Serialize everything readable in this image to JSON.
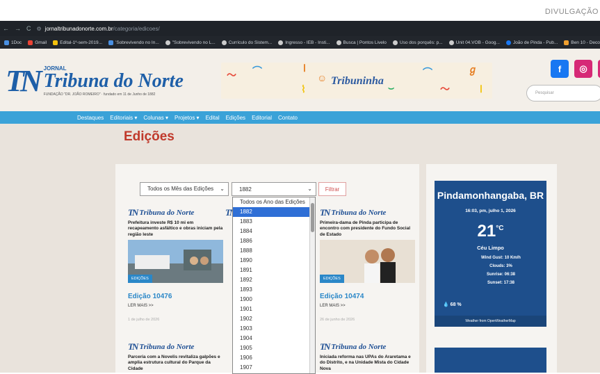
{
  "credit": "DIVULGAÇÃO",
  "browser": {
    "back": "←",
    "forward": "→",
    "reload": "C",
    "url_host": "jornaltribunadonorte.com.br",
    "url_path": "/categoria/edicoes/"
  },
  "bookmarks": [
    "1Doc",
    "Gmail",
    "Edital-1º-sem-2019...",
    "'Sobrevivendo no In...",
    "\"Sobrevivendo no L...",
    "Currículo do Sistem...",
    "Ingresso - IEB - Insti...",
    "Busca | Pontos Livelo",
    "Uso dos porquês: p...",
    "Unit 04.VOB - Goog...",
    "João de Pinda - Pub...",
    "Ben 10 - Deco"
  ],
  "header": {
    "logo_mark": "TN",
    "logo_small": "JORNAL",
    "logo_name": "Tribuna do Norte",
    "logo_sub": "FUNDAÇÃO \"DR. JOÃO ROMEIRO\" · fundado em 11 de Junho de 1882",
    "banner": "Tribuninha",
    "social": [
      {
        "icon": "f",
        "color": "#1877f2"
      },
      {
        "icon": "◎",
        "color": "#d62976"
      }
    ],
    "search_placeholder": "Pesquisar"
  },
  "menu": [
    "Destaques",
    "Editoriais ▾",
    "Colunas ▾",
    "Projetos ▾",
    "Edital",
    "Edições",
    "Editorial",
    "Contato"
  ],
  "page_title": "Edições",
  "filters": {
    "month": "Todos os Mês das Edições",
    "year": "1882",
    "button": "Filtrar"
  },
  "year_options": [
    "Todos os Ano das Edições",
    "1882",
    "1883",
    "1884",
    "1886",
    "1888",
    "1890",
    "1891",
    "1892",
    "1893",
    "1900",
    "1901",
    "1902",
    "1903",
    "1904",
    "1905",
    "1906",
    "1907"
  ],
  "cards": [
    {
      "paper": "Tribuna do Norte",
      "headline": "Prefeitura investe R$ 10 mi em recapeamento asfáltico e obras iniciam pela região leste",
      "tag": "EDIÇÕES",
      "title": "Edição 10476",
      "more": "LER MAIS >>",
      "date": "1 de julho de 2026"
    },
    {
      "paper": "Tribuna do Norte",
      "headline": "Primeira-dama de Pinda participa de encontro com presidente do Fundo Social de Estado",
      "tag": "EDIÇÕES",
      "title": "Edição 10474",
      "more": "LER MAIS >>",
      "date": "26 de junho de 2026"
    },
    {
      "paper": "Tribuna do Norte",
      "headline": "Parceria com a Novelis revitaliza galpões e amplia estrutura cultural do Parque da Cidade"
    },
    {
      "paper": "Tribuna do Norte",
      "headline": "Iniciada reforma nas UPAs do Araretama e do Distrito, e na Unidade Mista do Cidade Nova"
    }
  ],
  "weather": {
    "city": "Pindamonhangaba, BR",
    "time": "16:03, pm, julho 1, 2026",
    "temp": "21",
    "unit": "°C",
    "condition": "Céu Limpo",
    "wind": "Wind Gust: 10 Km/h",
    "clouds": "Clouds: 3%",
    "sunrise": "Sunrise: 06:38",
    "sunset": "Sunset: 17:38",
    "humidity": "68 %",
    "footer": "Weather from OpenWeatherMap"
  }
}
